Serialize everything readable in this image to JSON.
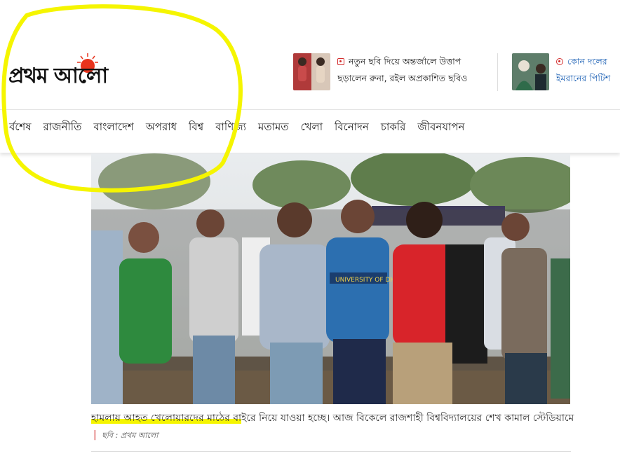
{
  "brand": {
    "logo_text": "প্রথম আলো",
    "accent_color": "#e8331c"
  },
  "teasers": [
    {
      "line1": "নতুন ছবি দিয়ে অন্তর্জালে উত্তাপ",
      "line2": "ছড়ালেন রুনা, রইল অপ্রকাশিত ছবিও",
      "icon": "camera-icon"
    },
    {
      "line1": "কোন দলের",
      "line2": "ইমরানের পিটিশ",
      "icon": "play-icon"
    }
  ],
  "nav": {
    "items": [
      "র্বশেষ",
      "রাজনীতি",
      "বাংলাদেশ",
      "অপরাধ",
      "বিশ্ব",
      "বাণিজ্য",
      "মতামত",
      "খেলা",
      "বিনোদন",
      "চাকরি",
      "জীবনযাপন"
    ]
  },
  "photo": {
    "jersey_text": "UNIVERSITY OF DHAKA"
  },
  "caption": {
    "highlighted": "হামলায় আহত খেলোয়ারদের মাঠের বা",
    "rest": "ইরে নিয়ে যাওয়া হচ্ছে। আজ বিকেলে রাজশাহী বিশ্ববিদ্যালয়ের শেখ কামাল স্টেডিয়ামে",
    "separator": "|",
    "credit": "ছবি : প্রথম আলো"
  },
  "colors": {
    "highlight": "#f5f500"
  }
}
